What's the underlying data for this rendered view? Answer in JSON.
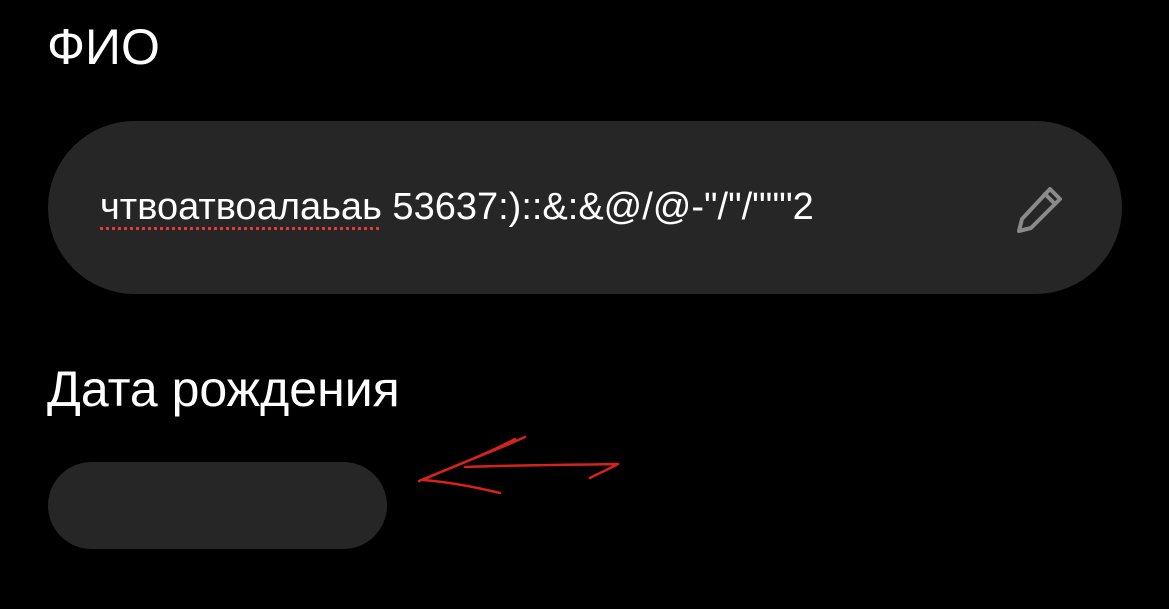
{
  "form": {
    "full_name": {
      "label": "ФИО",
      "value_misspelled": "чтвоатвоалаьаь",
      "value_rest": " 53637:)::&:&@/@-\"/\"/\"\"\"2",
      "icon": "pencil-icon"
    },
    "birth_date": {
      "label": "Дата рождения",
      "value": ""
    }
  },
  "annotation": {
    "icon": "hand-drawn-arrow",
    "color": "#d4231c"
  },
  "colors": {
    "background": "#000000",
    "field_background": "#262626",
    "text": "#ffffff",
    "icon": "#8a8a8a",
    "spellcheck_underline": "#e23b3b"
  }
}
